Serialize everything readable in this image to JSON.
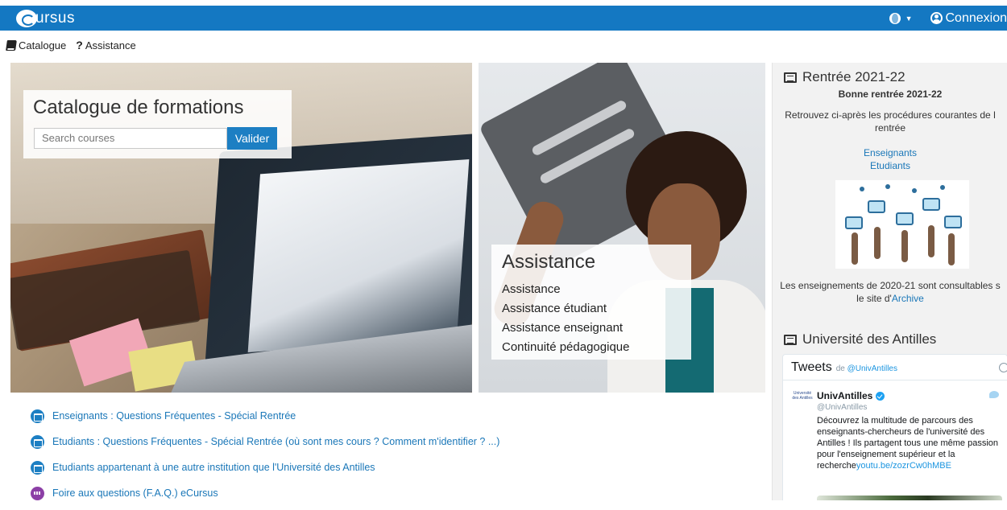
{
  "navbar": {
    "logo_text": "ursus",
    "login_label": "Connexion",
    "language_icon": "globe-icon",
    "login_icon": "user-circle-icon",
    "brand_color": "#1478c2"
  },
  "subnav": {
    "items": [
      {
        "label": "Catalogue",
        "icon": "book-icon"
      },
      {
        "label": "Assistance",
        "icon": "question-icon"
      }
    ]
  },
  "hero": {
    "catalogue": {
      "title": "Catalogue de formations",
      "search_placeholder": "Search courses",
      "search_button": "Valider"
    },
    "assistance": {
      "title": "Assistance",
      "links": [
        "Assistance",
        "Assistance étudiant",
        "Assistance enseignant",
        "Continuité pédagogique"
      ]
    }
  },
  "faq": {
    "items": [
      {
        "label": "Enseignants : Questions Fréquentes - Spécial Rentrée",
        "icon": "calendar-icon"
      },
      {
        "label": "Etudiants : Questions Fréquentes - Spécial Rentrée (où sont mes cours ? Comment m'identifier ? ...)",
        "icon": "calendar-icon"
      },
      {
        "label": "Etudiants appartenant à une autre institution que l'Université des Antilles",
        "icon": "calendar-icon"
      },
      {
        "label": "Foire aux questions (F.A.Q.) eCursus",
        "icon": "people-icon"
      }
    ]
  },
  "sidebar": {
    "rentree": {
      "title": "Rentrée 2021-22",
      "subtitle": "Bonne rentrée 2021-22",
      "intro_line1": "Retrouvez ci-après les procédures courantes de l",
      "intro_line2": "rentrée",
      "link_enseignants": "Enseignants",
      "link_etudiants": "Etudiants",
      "archive_line1": "Les enseignements de 2020-21 sont consultables s",
      "archive_prefix": "le site d'",
      "archive_link": "Archive"
    },
    "universite": {
      "title": "Université des Antilles",
      "tweets_title": "Tweets",
      "tweets_by_prefix": "de",
      "tweets_by_handle": "@UnivAntilles",
      "avatar_text": "Université des Antilles",
      "tweet": {
        "name": "UnivAntilles",
        "handle": "@UnivAntilles",
        "text": "Découvrez la multitude de parcours des enseignants-chercheurs de l'université des Antilles ! Ils partagent tous une même passion pour l'enseignement supérieur et la recherche",
        "link": "youtu.be/zozrCw0hMBE"
      }
    }
  }
}
